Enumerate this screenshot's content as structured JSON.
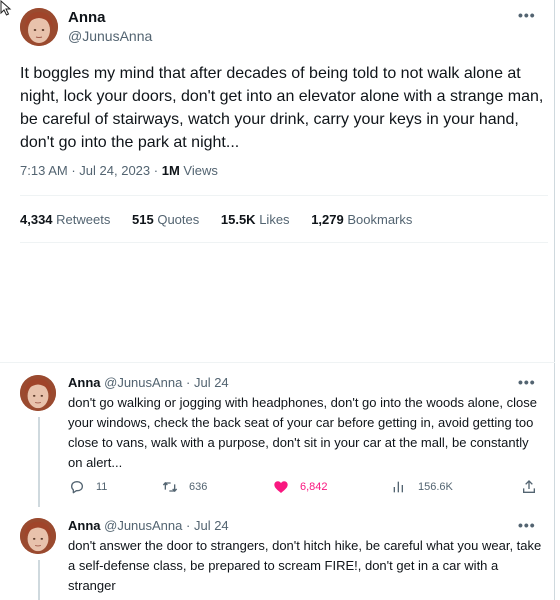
{
  "main_tweet": {
    "author_name": "Anna",
    "author_handle": "@JunusAnna",
    "text": "It boggles my mind that after decades of being told to not walk alone at night, lock your doors, don't get into an elevator alone with a strange man, be careful of stairways, watch your drink, carry your keys in your hand, don't go into the park at night...",
    "time": "7:13 AM",
    "date": "Jul 24, 2023",
    "views_count": "1M",
    "views_label": "Views",
    "stats": {
      "retweets_count": "4,334",
      "retweets_label": "Retweets",
      "quotes_count": "515",
      "quotes_label": "Quotes",
      "likes_count": "15.5K",
      "likes_label": "Likes",
      "bookmarks_count": "1,279",
      "bookmarks_label": "Bookmarks"
    }
  },
  "replies": [
    {
      "author_name": "Anna",
      "author_handle": "@JunusAnna",
      "date": "Jul 24",
      "text": "don't go walking or jogging with headphones, don't go into the woods alone, close your windows, check the back seat of your car before getting in, avoid getting too close to vans, walk with a purpose, don't sit in your car at the mall, be constantly on alert...",
      "actions": {
        "replies": "11",
        "retweets": "636",
        "likes": "6,842",
        "views": "156.6K"
      }
    },
    {
      "author_name": "Anna",
      "author_handle": "@JunusAnna",
      "date": "Jul 24",
      "text": "don't answer the door to strangers, don't hitch hike, be careful what you wear, take a self-defense class, be prepared to scream FIRE!, don't get in a car with a stranger"
    }
  ],
  "separator": "·",
  "icons": {
    "more": "more-horizontal-icon",
    "reply": "reply-icon",
    "retweet": "retweet-icon",
    "like": "heart-filled-icon",
    "views": "analytics-icon",
    "share": "share-icon"
  },
  "colors": {
    "like_accent": "#f91880",
    "text_primary": "#0f1419",
    "text_secondary": "#536471"
  }
}
